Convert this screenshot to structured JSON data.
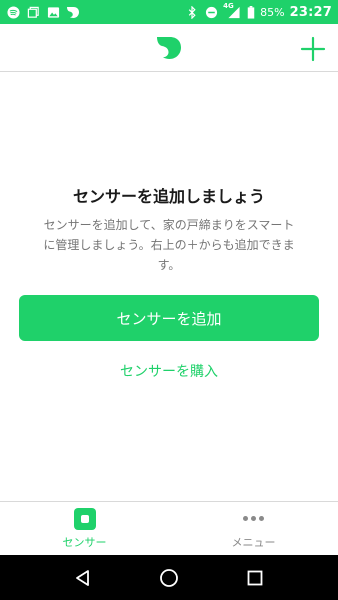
{
  "status_bar": {
    "left_icons": [
      "spotify-icon",
      "copy-icon",
      "image-icon",
      "app-logo-icon"
    ],
    "right_icons": [
      "bluetooth-icon",
      "do-not-disturb-icon",
      "signal-4g-icon",
      "battery-icon"
    ],
    "network": "4G",
    "battery": "85%",
    "time": "23:27"
  },
  "app_bar": {
    "logo_icon": "leaf-logo-icon",
    "add_icon": "plus-icon"
  },
  "empty_state": {
    "title": "センサーを追加しましょう",
    "description": "センサーを追加して、家の戸締まりをスマートに管理しましょう。右上の＋からも追加できます。",
    "primary_button": "センサーを追加",
    "secondary_link": "センサーを購入"
  },
  "tab_bar": {
    "tabs": [
      {
        "label": "センサー",
        "icon": "sensor-icon",
        "active": true
      },
      {
        "label": "メニュー",
        "icon": "more-dots-icon",
        "active": false
      }
    ]
  },
  "nav_bar": {
    "buttons": [
      "back-triangle-icon",
      "home-circle-icon",
      "recents-square-icon"
    ]
  },
  "colors": {
    "accent": "#1fd16a",
    "text_primary": "#1a1a1a",
    "text_secondary": "#757575",
    "tab_inactive": "#8a8a8a",
    "nav_bg": "#000000"
  }
}
